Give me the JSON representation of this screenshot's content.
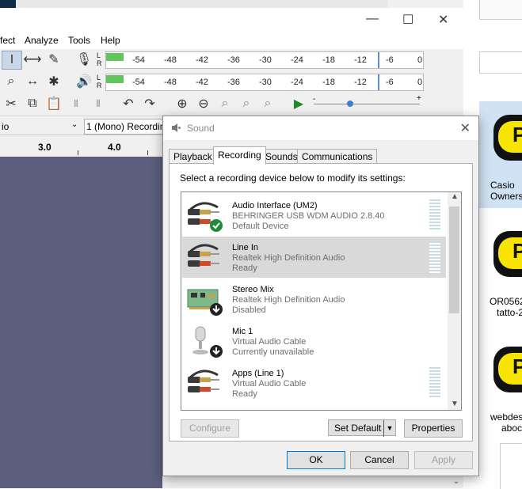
{
  "audacity": {
    "menus": [
      "fect",
      "Analyze",
      "Tools",
      "Help"
    ],
    "meter_ticks": [
      "-54",
      "-48",
      "-42",
      "-36",
      "-30",
      "-24",
      "-18",
      "-12",
      "-6",
      "0"
    ],
    "meter_lr": {
      "l": "L",
      "r": "R"
    },
    "track_dropdown_left": "io",
    "track_dropdown_right": "1 (Mono) Recordin",
    "ruler": [
      "3.0",
      "4.0"
    ]
  },
  "desktop": {
    "items": [
      {
        "label": "Casio",
        "label2": "Owners"
      },
      {
        "label": "OR0562(",
        "label2": "tatto-2"
      },
      {
        "label": "webdes",
        "label2": "aboc"
      }
    ],
    "icon_letter": "P"
  },
  "dialog": {
    "title": "Sound",
    "tabs": [
      "Playback",
      "Recording",
      "Sounds",
      "Communications"
    ],
    "active_tab": "Recording",
    "instruction": "Select a recording device below to modify its settings:",
    "devices": [
      {
        "name": "Audio Interface (UM2)",
        "sub": "BEHRINGER USB WDM AUDIO 2.8.40",
        "status": "Default Device",
        "icon": "rca-plugs-icon",
        "badge": "check"
      },
      {
        "name": "Line In",
        "sub": "Realtek High Definition Audio",
        "status": "Ready",
        "icon": "rca-plugs-icon",
        "badge": "none"
      },
      {
        "name": "Stereo Mix",
        "sub": "Realtek High Definition Audio",
        "status": "Disabled",
        "icon": "sound-card-icon",
        "badge": "down"
      },
      {
        "name": "Mic 1",
        "sub": "Virtual Audio Cable",
        "status": "Currently unavailable",
        "icon": "microphone-icon",
        "badge": "down"
      },
      {
        "name": "Apps (Line 1)",
        "sub": "Virtual Audio Cable",
        "status": "Ready",
        "icon": "rca-plugs-icon",
        "badge": "none"
      }
    ],
    "buttons": {
      "configure": "Configure",
      "set_default": "Set Default",
      "properties": "Properties",
      "ok": "OK",
      "cancel": "Cancel",
      "apply": "Apply"
    }
  },
  "colors": {
    "track_bg": "#5c5e7e",
    "meter_green": "#62c45a",
    "selection": "#d9d9d9",
    "desk_icon_yellow": "#f7e400"
  }
}
